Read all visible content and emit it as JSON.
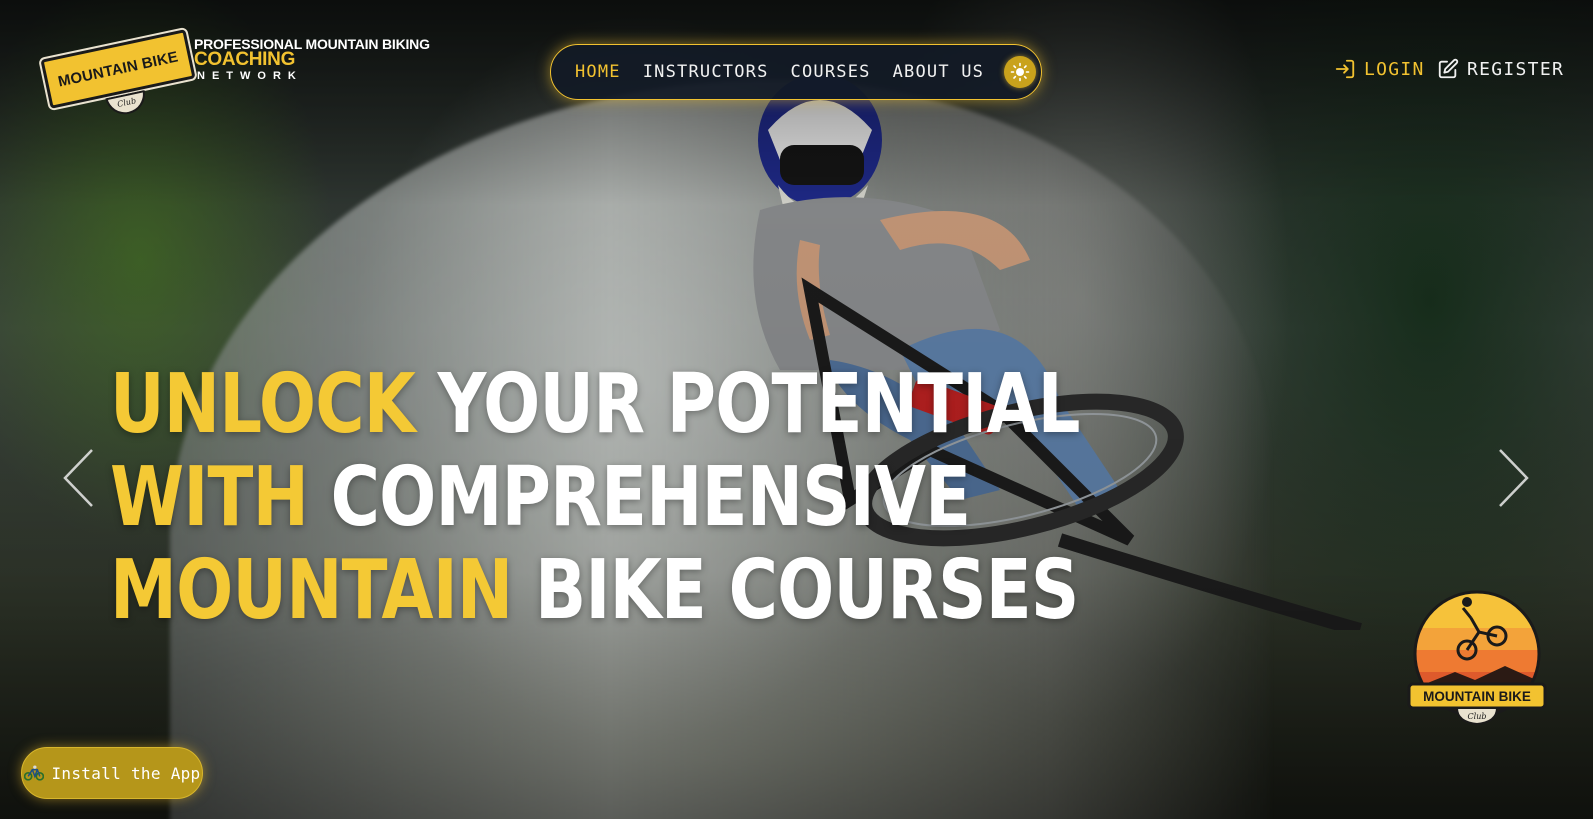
{
  "brand": {
    "badge_text": "MOUNTAIN BIKE",
    "badge_club": "Club",
    "tagline_1": "PROFESSIONAL MOUNTAIN BIKING",
    "tagline_2": "COACHING",
    "tagline_3": "NETWORK"
  },
  "nav": {
    "items": [
      {
        "label": "HOME",
        "active": true
      },
      {
        "label": "INSTRUCTORS",
        "active": false
      },
      {
        "label": "COURSES",
        "active": false
      },
      {
        "label": "ABOUT US",
        "active": false
      }
    ],
    "theme_toggle_icon": "sun-icon"
  },
  "auth": {
    "login_label": "LOGIN",
    "register_label": "REGISTER"
  },
  "hero": {
    "lines": [
      {
        "highlight": "UNLOCK",
        "rest": " YOUR POTENTIAL"
      },
      {
        "highlight": "WITH",
        "rest": " COMPREHENSIVE"
      },
      {
        "highlight": "MOUNTAIN",
        "rest": " BIKE COURSES"
      }
    ]
  },
  "club_logo": {
    "text": "MOUNTAIN BIKE",
    "sub": "Club"
  },
  "install": {
    "icon": "bicycle-icon",
    "label": "Install the App"
  },
  "colors": {
    "accent": "#f4c935",
    "nav_bg": "#121a26",
    "install_bg": "#b5961a"
  }
}
